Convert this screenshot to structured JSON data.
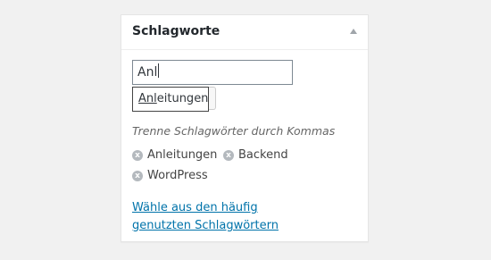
{
  "metabox": {
    "title": "Schlagworte"
  },
  "tag_input": {
    "value": "Anl"
  },
  "suggestion": {
    "match": "Anl",
    "rest": "eitungen"
  },
  "howto": "Trenne Schlagwörter durch Kommas",
  "tags": [
    {
      "label": "Anleitungen",
      "remove_icon": "x"
    },
    {
      "label": "Backend",
      "remove_icon": "x"
    },
    {
      "label": "WordPress",
      "remove_icon": "x"
    }
  ],
  "tagcloud_link": "Wähle aus den häufig genutzten Schlagwörtern"
}
